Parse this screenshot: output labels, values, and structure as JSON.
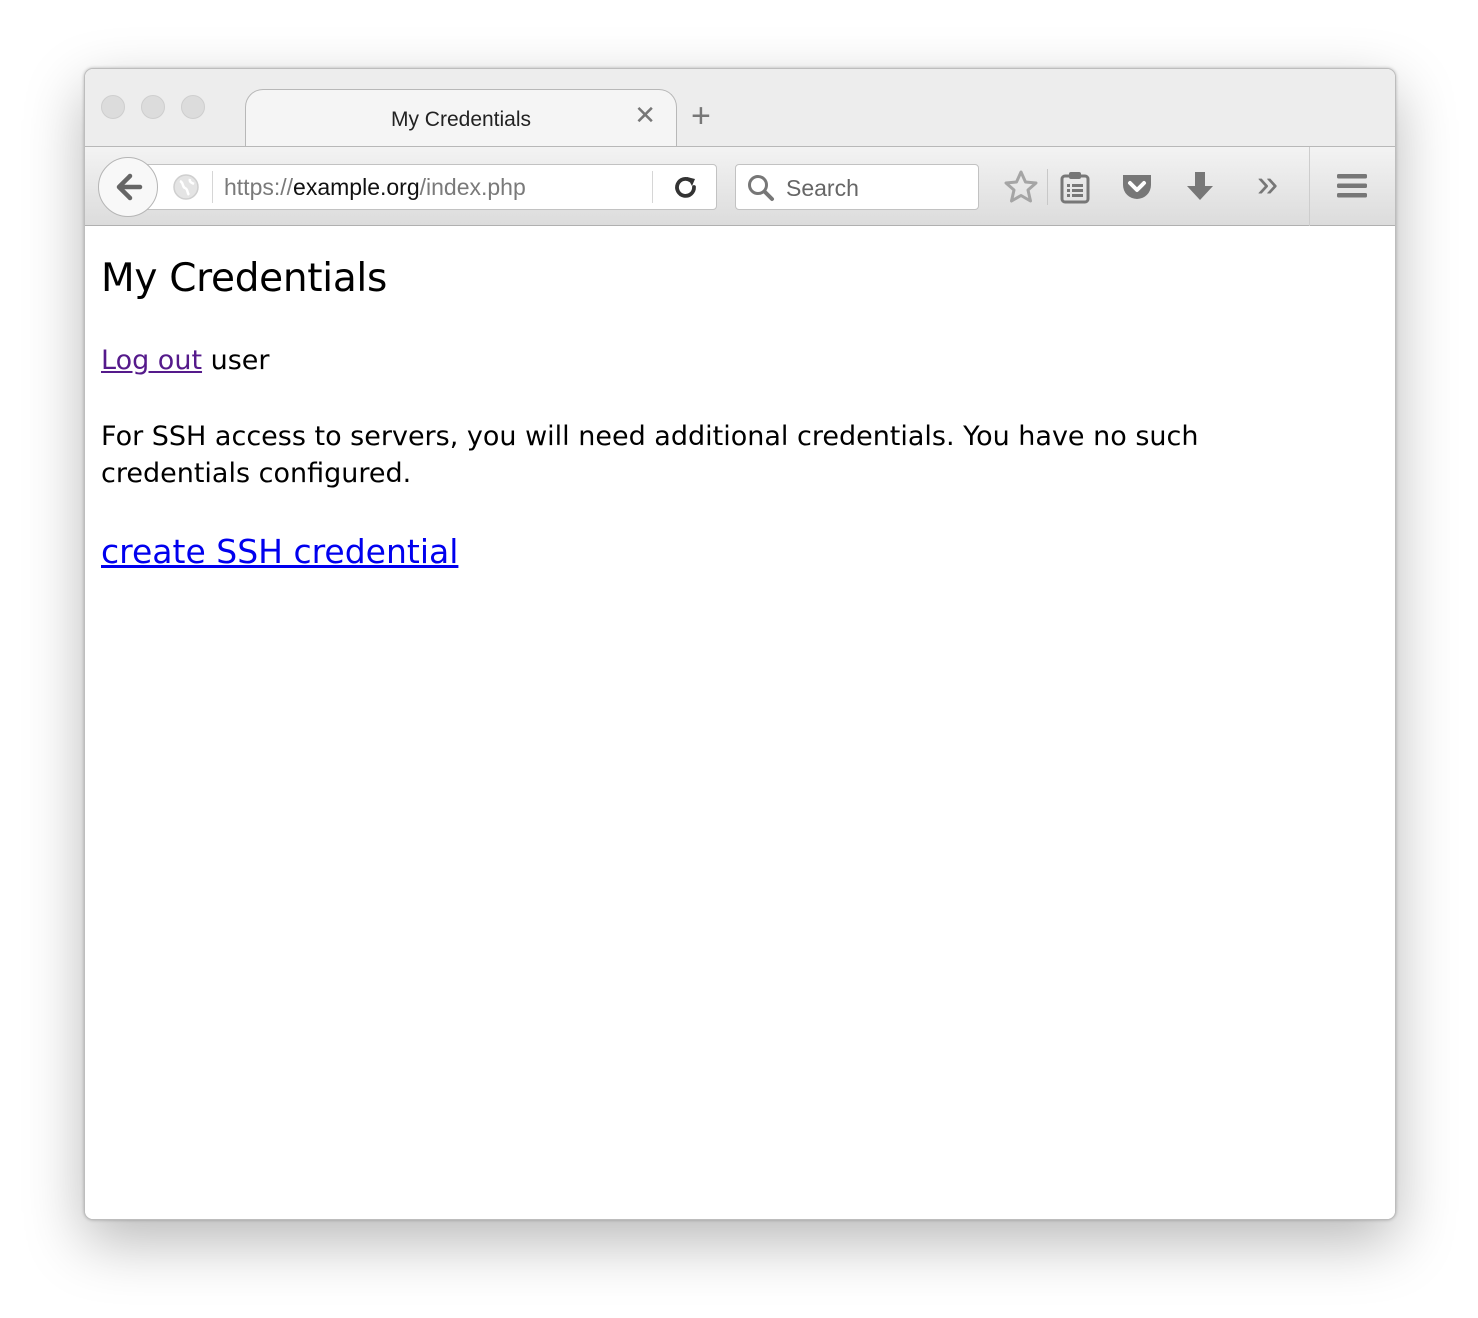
{
  "tab": {
    "title": "My Credentials",
    "close_glyph": "✕",
    "new_tab_glyph": "+"
  },
  "urlbar": {
    "scheme": "https://",
    "host": "example.org",
    "path": "/index.php"
  },
  "searchbar": {
    "placeholder": "Search"
  },
  "toolbar": {
    "icons": [
      "back-icon",
      "globe-icon",
      "reload-icon",
      "search-icon",
      "bookmark-star-icon",
      "reading-list-icon",
      "pocket-icon",
      "download-icon",
      "overflow-chevron-icon",
      "hamburger-menu-icon"
    ],
    "overflow_glyph": "»"
  },
  "page": {
    "heading": "My Credentials",
    "logout_link": "Log out",
    "username": "user",
    "info_text": "For SSH access to servers, you will need additional credentials. You have no such credentials configured.",
    "create_link": "create SSH credential"
  },
  "colors": {
    "visited_link": "#551a8b",
    "link": "#0000ee"
  }
}
